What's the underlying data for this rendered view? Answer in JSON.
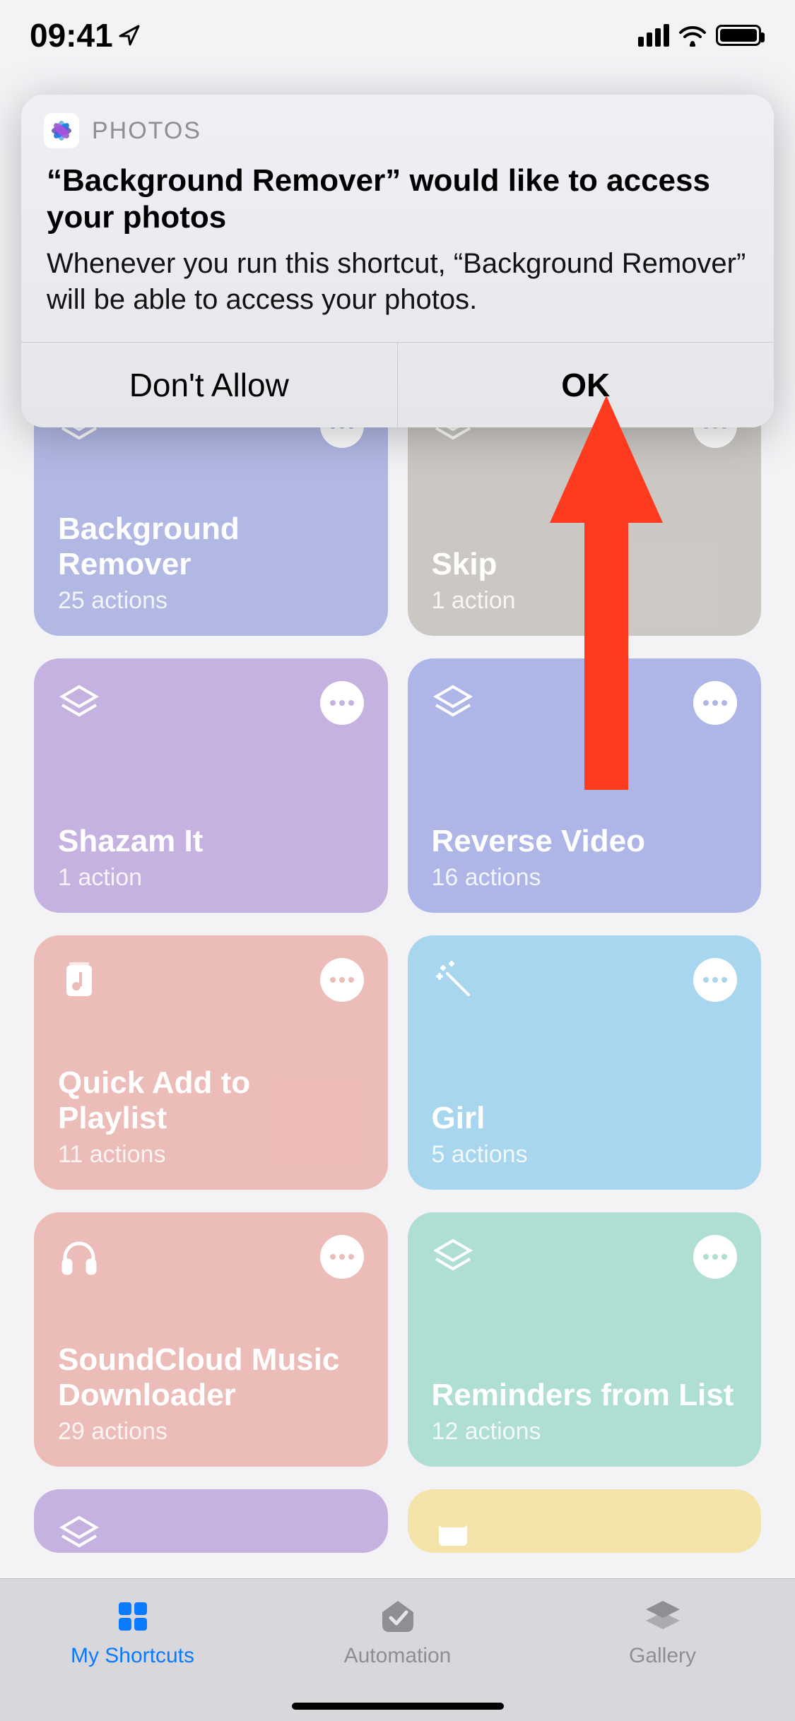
{
  "status": {
    "time": "09:41"
  },
  "alert": {
    "app_label": "PHOTOS",
    "title": "“Background Remover” would like to access your photos",
    "message": "Whenever you run this shortcut, “Background Remover” will be able to access your photos.",
    "deny_label": "Don't Allow",
    "allow_label": "OK"
  },
  "shortcuts": [
    {
      "title": "Background Remover",
      "sub": "25 actions",
      "bg": "#5263c4",
      "dot": "#5263c4",
      "icon": "stack"
    },
    {
      "title": "Skip",
      "sub": "1 action",
      "bg": "#8d857d",
      "dot": "#8d857d",
      "icon": "stack"
    },
    {
      "title": "Shazam It",
      "sub": "1 action",
      "bg": "#7f55bd",
      "dot": "#7f55bd",
      "icon": "stack"
    },
    {
      "title": "Reverse Video",
      "sub": "16 actions",
      "bg": "#4b5ec9",
      "dot": "#4b5ec9",
      "icon": "stack"
    },
    {
      "title": "Quick Add to Playlist",
      "sub": "11 actions",
      "bg": "#d66a62",
      "dot": "#d66a62",
      "icon": "music"
    },
    {
      "title": "Girl",
      "sub": "5 actions",
      "bg": "#3ea4d9",
      "dot": "#3ea4d9",
      "icon": "wand"
    },
    {
      "title": "SoundCloud Music Downloader",
      "sub": "29 actions",
      "bg": "#d66a62",
      "dot": "#d66a62",
      "icon": "headphones"
    },
    {
      "title": "Reminders from List",
      "sub": "12 actions",
      "bg": "#4fb79d",
      "dot": "#4fb79d",
      "icon": "stack"
    },
    {
      "title": "",
      "sub": "",
      "bg": "#7f55bd",
      "dot": "#7f55bd",
      "icon": "stack"
    },
    {
      "title": "",
      "sub": "",
      "bg": "#e8c443",
      "dot": "#e8c443",
      "icon": "note"
    }
  ],
  "tabs": {
    "shortcuts": "My Shortcuts",
    "automation": "Automation",
    "gallery": "Gallery"
  }
}
